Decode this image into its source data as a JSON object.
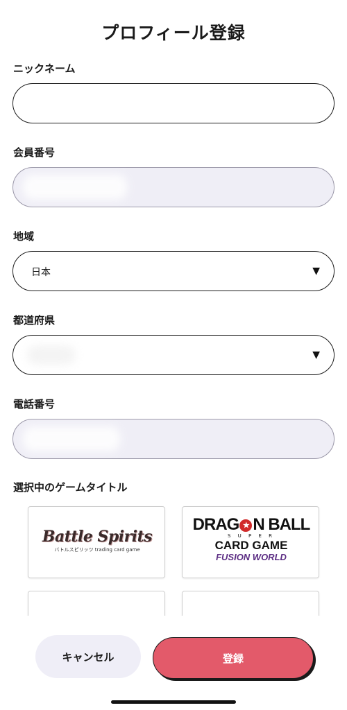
{
  "header": {
    "title": "プロフィール登録"
  },
  "form": {
    "nickname": {
      "label": "ニックネーム",
      "value": ""
    },
    "member_number": {
      "label": "会員番号"
    },
    "region": {
      "label": "地域",
      "value": "日本"
    },
    "prefecture": {
      "label": "都道府県"
    },
    "phone": {
      "label": "電話番号"
    }
  },
  "games": {
    "label": "選択中のゲームタイトル",
    "cards": [
      {
        "name": "battle-spirits",
        "logo_text": "Battle Spirits",
        "subtitle": "バトルスピリッツ trading card game"
      },
      {
        "name": "dragon-ball-fusion-world",
        "line1a": "DRAG",
        "line1b": "N BALL",
        "line2": "S U P E R",
        "line3": "CARD GAME",
        "line4": "FUSION WORLD"
      }
    ]
  },
  "footer": {
    "cancel_label": "キャンセル",
    "submit_label": "登録"
  },
  "colors": {
    "accent": "#e35a6a",
    "readonly_bg": "#efeef6",
    "cancel_bg": "#efeef7"
  }
}
